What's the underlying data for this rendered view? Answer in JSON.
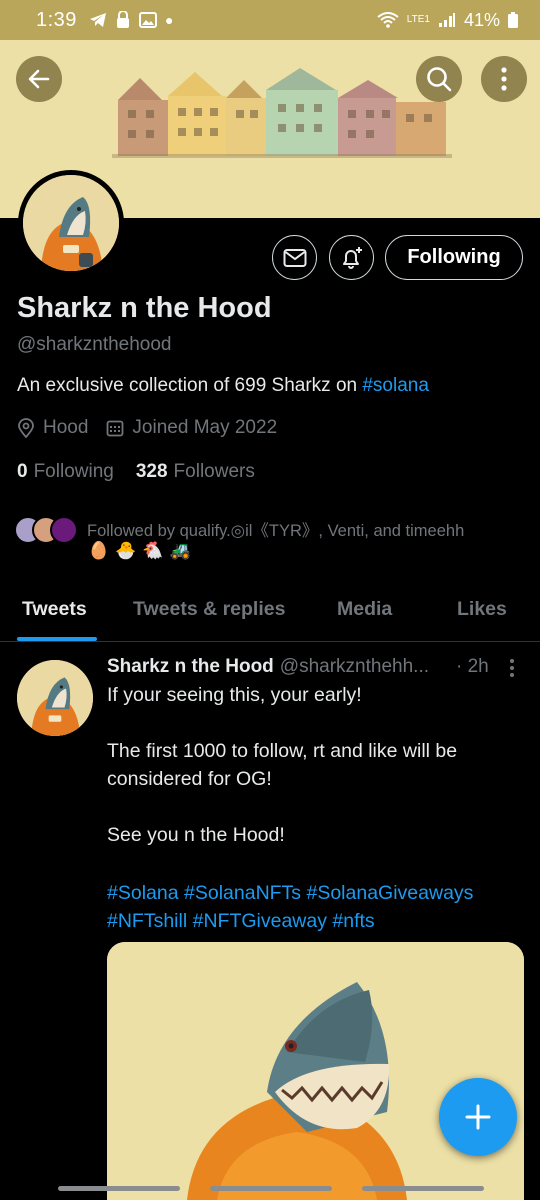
{
  "status_bar": {
    "time": "1:39",
    "battery": "41%",
    "network": "LTE1"
  },
  "profile": {
    "name": "Sharkz n the Hood",
    "handle": "@sharkznthehood",
    "bio_text": "An exclusive collection of 699 Sharkz on ",
    "bio_tag": "#solana",
    "location": "Hood",
    "joined": "Joined May 2022",
    "following_count": "0",
    "following_label": "Following",
    "followers_count": "328",
    "followers_label": "Followers",
    "followed_by": "Followed by qualify.◎il《TYR》, Venti, and timeehh",
    "emojis": [
      "🥚",
      "🐣",
      "🐔",
      "🚜"
    ]
  },
  "buttons": {
    "follow_label": "Following"
  },
  "tabs": [
    {
      "label": "Tweets",
      "active": true
    },
    {
      "label": "Tweets & replies",
      "active": false
    },
    {
      "label": "Media",
      "active": false
    },
    {
      "label": "Likes",
      "active": false
    }
  ],
  "tweet": {
    "author": "Sharkz n the Hood",
    "handle": "@sharkznthehh...",
    "time": "· 2h",
    "lines": [
      "If your seeing this, your early!",
      "The first 1000 to follow, rt and like will be",
      "considered for OG!",
      "See you n the Hood!"
    ],
    "hashtags_line1": [
      "#Solana",
      "#SolanaNFTs",
      "#SolanaGiveaways"
    ],
    "hashtags_line2": [
      "#NFTshill",
      "#NFTGiveaway",
      "#nfts"
    ]
  },
  "colors": {
    "accent": "#1d9bf0",
    "banner": "#ede0a6",
    "status_bar": "#b9a65a"
  }
}
